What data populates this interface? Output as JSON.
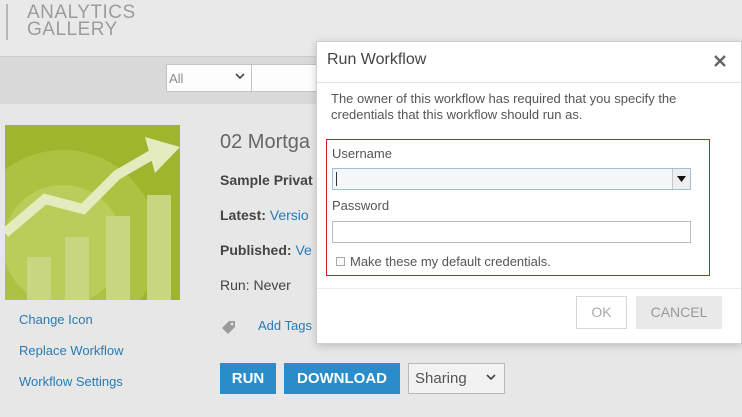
{
  "header": {
    "brand_line1": "ANALYTICS",
    "brand_line2": "GALLERY"
  },
  "filter": {
    "selected": "All",
    "chevron": "⌄"
  },
  "sidebar": {
    "links": [
      "Change Icon",
      "Replace Workflow",
      "Workflow Settings"
    ]
  },
  "workflow": {
    "title": "02 Mortga",
    "owner": "Sample Privat",
    "latest_label": "Latest:",
    "latest_value": "Versio",
    "published_label": "Published:",
    "published_value": "Ve",
    "run_line": "Run: Never",
    "add_tags": "Add Tags",
    "tag_icon": "tag-icon"
  },
  "actions": {
    "run": "RUN",
    "download": "DOWNLOAD",
    "sharing": "Sharing"
  },
  "modal": {
    "title": "Run Workflow",
    "close": "✕",
    "description": "The owner of this workflow has required that you specify the credentials that this workflow should run as.",
    "username_label": "Username",
    "username_value": "",
    "password_label": "Password",
    "password_value": "",
    "default_creds_label": "Make these my default credentials.",
    "ok": "OK",
    "cancel": "CANCEL"
  },
  "colors": {
    "accent": "#2a8cc9",
    "link": "#2a7bb4",
    "highlight_border": "#c81e1e",
    "thumbnail": "#a0b52e"
  }
}
